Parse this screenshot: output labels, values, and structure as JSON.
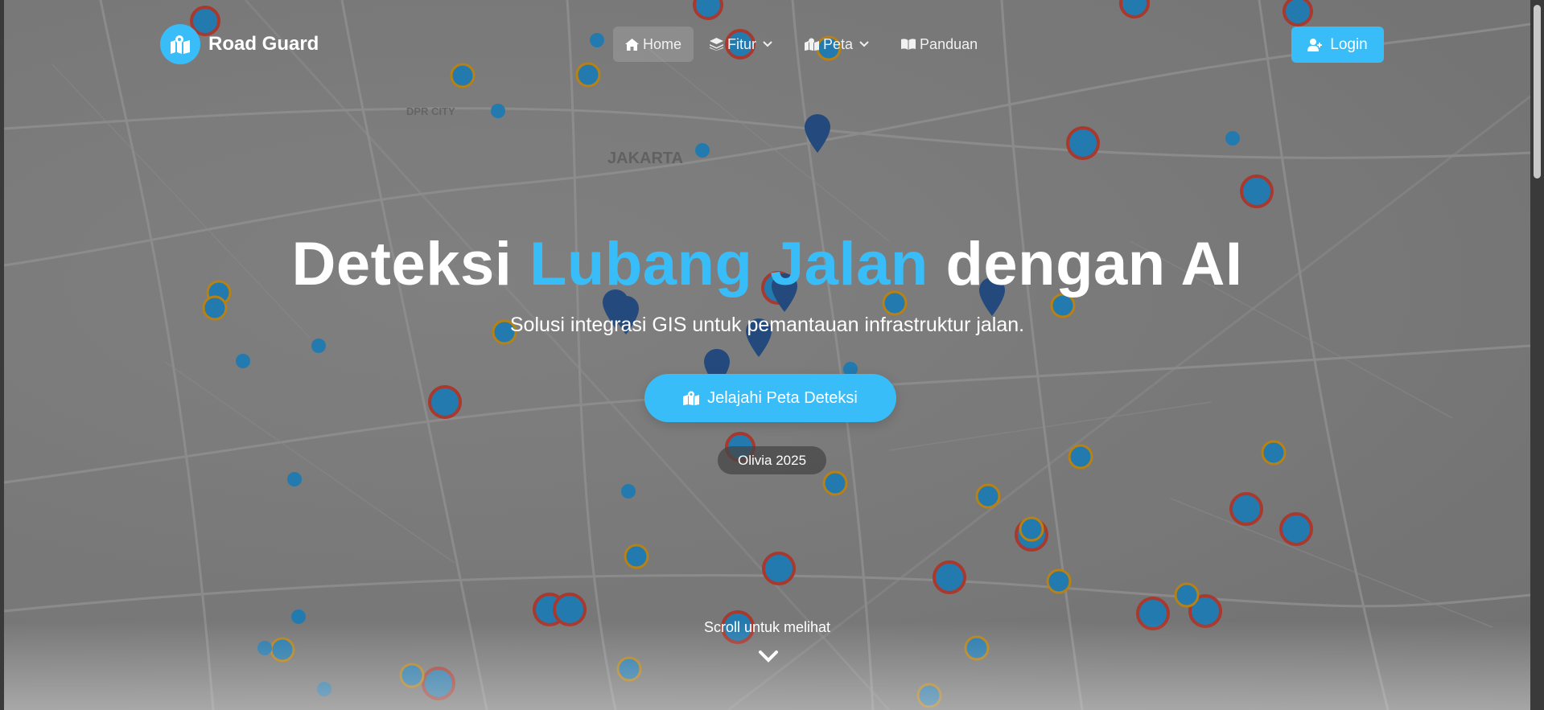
{
  "brand": {
    "name": "Road Guard",
    "logo_icon": "map-location-icon"
  },
  "nav": {
    "items": [
      {
        "label": "Home",
        "icon": "home-icon",
        "active": true,
        "dropdown": false
      },
      {
        "label": "Fitur",
        "icon": "layers-icon",
        "active": false,
        "dropdown": true
      },
      {
        "label": "Peta",
        "icon": "map-location-icon",
        "active": false,
        "dropdown": true
      },
      {
        "label": "Panduan",
        "icon": "book-icon",
        "active": false,
        "dropdown": false
      }
    ],
    "login_label": "Login"
  },
  "hero": {
    "title_part1": "Deteksi ",
    "title_accent": "Lubang Jalan",
    "title_part2": " dengan AI",
    "subtitle": "Solusi integrasi GIS untuk pemantauan infrastruktur jalan.",
    "cta_label": "Jelajahi Peta Deteksi",
    "badge": "Olivia 2025",
    "scroll_hint": "Scroll untuk melihat"
  },
  "map": {
    "labels": [
      "JAKARTA",
      "DPR CITY"
    ]
  },
  "colors": {
    "accent": "#38bdf8",
    "marker_red": "#c0392b",
    "marker_orange": "#d4900a",
    "marker_blue": "#1e88c9",
    "pin_dark": "#1f4e8c"
  }
}
